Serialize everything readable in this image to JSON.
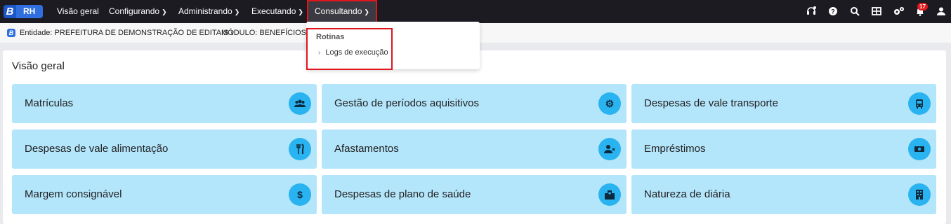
{
  "brand": {
    "letter": "B",
    "app": "RH"
  },
  "nav": {
    "visao_geral": "Visão geral",
    "configurando": "Configurando",
    "administrando": "Administrando",
    "executando": "Executando",
    "consultando": "Consultando"
  },
  "header_icons": [
    "headset-icon",
    "help-icon",
    "search-icon",
    "grid-icon",
    "settings-icon",
    "notifications-icon",
    "user-icon"
  ],
  "notifications": {
    "count": "17"
  },
  "context": {
    "entity": "Entidade: PREFEITURA DE DEMONSTRAÇÃO DE EDITAIS",
    "module": "MÓDULO: BENEFÍCIOS"
  },
  "dropdown": {
    "heading": "Rotinas",
    "items": [
      {
        "label": "Logs de execução"
      }
    ]
  },
  "main": {
    "title": "Visão geral",
    "cards": [
      {
        "label": "Matrículas",
        "icon": "users-icon"
      },
      {
        "label": "Gestão de períodos aquisitivos",
        "icon": "gear-icon"
      },
      {
        "label": "Despesas de vale transporte",
        "icon": "bus-icon"
      },
      {
        "label": "Despesas de vale alimentação",
        "icon": "utensils-icon"
      },
      {
        "label": "Afastamentos",
        "icon": "user-remove-icon"
      },
      {
        "label": "Empréstimos",
        "icon": "money-icon"
      },
      {
        "label": "Margem consignável",
        "icon": "dollar-icon"
      },
      {
        "label": "Despesas de plano de saúde",
        "icon": "hospital-icon"
      },
      {
        "label": "Natureza de diária",
        "icon": "building-icon"
      }
    ]
  },
  "colors": {
    "topbar": "#1c1b22",
    "card": "#b3e5fb",
    "card_icon": "#29b3f0",
    "highlight": "#e0161d",
    "brand": "#2f6fe0"
  }
}
